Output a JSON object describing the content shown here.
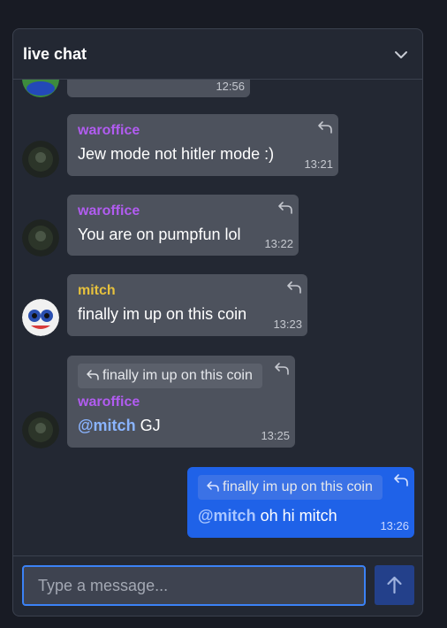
{
  "header": {
    "title": "live chat"
  },
  "messages": [
    {
      "author": "",
      "text": "",
      "time": "12:56"
    },
    {
      "author": "waroffice",
      "text": "Jew mode not hitler mode :)",
      "time": "13:21"
    },
    {
      "author": "waroffice",
      "text": "You are on pumpfun lol",
      "time": "13:22"
    },
    {
      "author": "mitch",
      "text": "finally im up on this coin",
      "time": "13:23"
    },
    {
      "author": "waroffice",
      "reply_to": "finally im up on this coin",
      "mention": "@mitch",
      "text": " GJ",
      "time": "13:25"
    },
    {
      "author": "",
      "reply_to": "finally im up on this coin",
      "mention": "@mitch",
      "text": " oh hi mitch",
      "time": "13:26"
    }
  ],
  "composer": {
    "placeholder": "Type a message..."
  },
  "colors": {
    "waroffice": "#b15cf0",
    "mitch": "#e6c13d",
    "own_bubble": "#1f62e8",
    "accent": "#3b82f6"
  },
  "icons": {
    "collapse": "chevron-down-icon",
    "reply": "reply-icon",
    "send": "arrow-up-icon"
  }
}
